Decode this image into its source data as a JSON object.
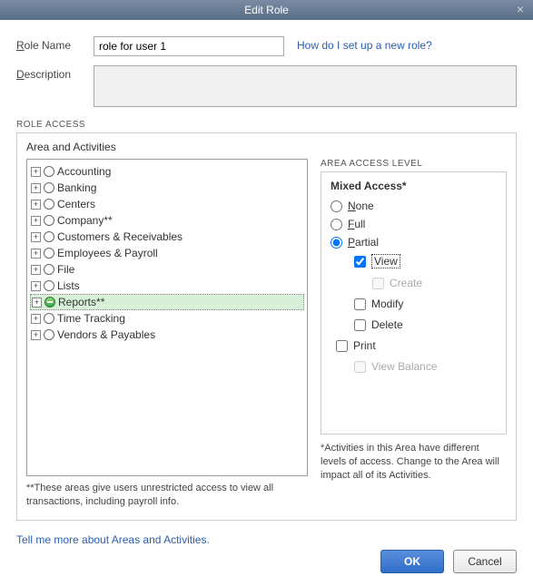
{
  "titlebar": {
    "title": "Edit Role"
  },
  "form": {
    "roleName": {
      "label_pre": "R",
      "label_post": "ole Name",
      "value": "role for user 1"
    },
    "helpLink": "How do I set up a new role?",
    "desc": {
      "label_pre": "D",
      "label_post": "escription"
    }
  },
  "section": {
    "label": "ROLE ACCESS",
    "areaLabel": "Area and Activities"
  },
  "tree": [
    {
      "label": "Accounting",
      "filled": false,
      "selected": false
    },
    {
      "label": "Banking",
      "filled": false,
      "selected": false
    },
    {
      "label": "Centers",
      "filled": false,
      "selected": false
    },
    {
      "label": "Company**",
      "filled": false,
      "selected": false
    },
    {
      "label": "Customers & Receivables",
      "filled": false,
      "selected": false
    },
    {
      "label": "Employees & Payroll",
      "filled": false,
      "selected": false
    },
    {
      "label": "File",
      "filled": false,
      "selected": false
    },
    {
      "label": "Lists",
      "filled": false,
      "selected": false
    },
    {
      "label": "Reports**",
      "filled": true,
      "selected": true
    },
    {
      "label": "Time Tracking",
      "filled": false,
      "selected": false
    },
    {
      "label": "Vendors & Payables",
      "filled": false,
      "selected": false
    }
  ],
  "treeNote": "**These areas give users unrestricted access to view all transactions, including payroll info.",
  "aal": {
    "header": "AREA ACCESS LEVEL",
    "title": "Mixed Access*",
    "radios": {
      "none": {
        "u": "N",
        "rest": "one"
      },
      "full": {
        "u": "F",
        "rest": "ull"
      },
      "partial": {
        "u": "P",
        "rest": "artial"
      }
    },
    "checks": {
      "view": {
        "u": "V",
        "rest": "iew",
        "checked": true,
        "enabled": true,
        "boxed": true
      },
      "create": {
        "u": "C",
        "rest": "reate",
        "checked": false,
        "enabled": false
      },
      "modify": {
        "u": "M",
        "rest": "odify",
        "checked": false,
        "enabled": true
      },
      "delete": {
        "pre": "D",
        "u": "e",
        "rest": "lete",
        "checked": false,
        "enabled": true
      },
      "print": {
        "label": "Print",
        "checked": false,
        "enabled": true
      },
      "viewBalance": {
        "pre": "View ",
        "u": "B",
        "rest": "alance",
        "checked": false,
        "enabled": false
      }
    },
    "note": "*Activities in this Area have different levels of access. Change to the Area will impact all of its Activities."
  },
  "bottomLink": "Tell me more about Areas and Activities.",
  "buttons": {
    "ok": "OK",
    "cancel": "Cancel"
  }
}
